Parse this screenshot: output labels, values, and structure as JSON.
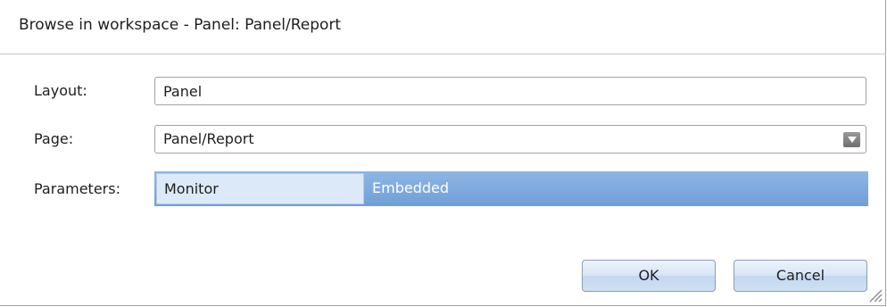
{
  "dialog": {
    "title": "Browse in workspace - Panel: Panel/Report"
  },
  "form": {
    "layout": {
      "label": "Layout:",
      "value": "Panel"
    },
    "page": {
      "label": "Page:",
      "value": "Panel/Report"
    },
    "parameters": {
      "label": "Parameters:",
      "rows": [
        {
          "name": "Monitor",
          "value": "Embedded"
        }
      ]
    }
  },
  "buttons": {
    "ok": "OK",
    "cancel": "Cancel"
  },
  "colors": {
    "selection": "#7aa7dc",
    "button_face": "#d8e6f5"
  }
}
